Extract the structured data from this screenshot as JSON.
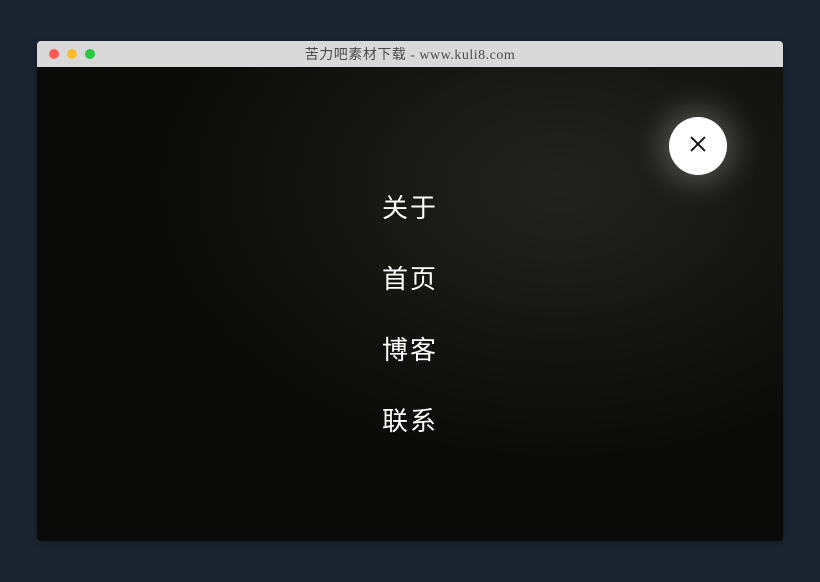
{
  "window": {
    "title": "苦力吧素材下载 - www.kuli8.com"
  },
  "menu": {
    "items": [
      {
        "label": "关于"
      },
      {
        "label": "首页"
      },
      {
        "label": "博客"
      },
      {
        "label": "联系"
      }
    ]
  }
}
